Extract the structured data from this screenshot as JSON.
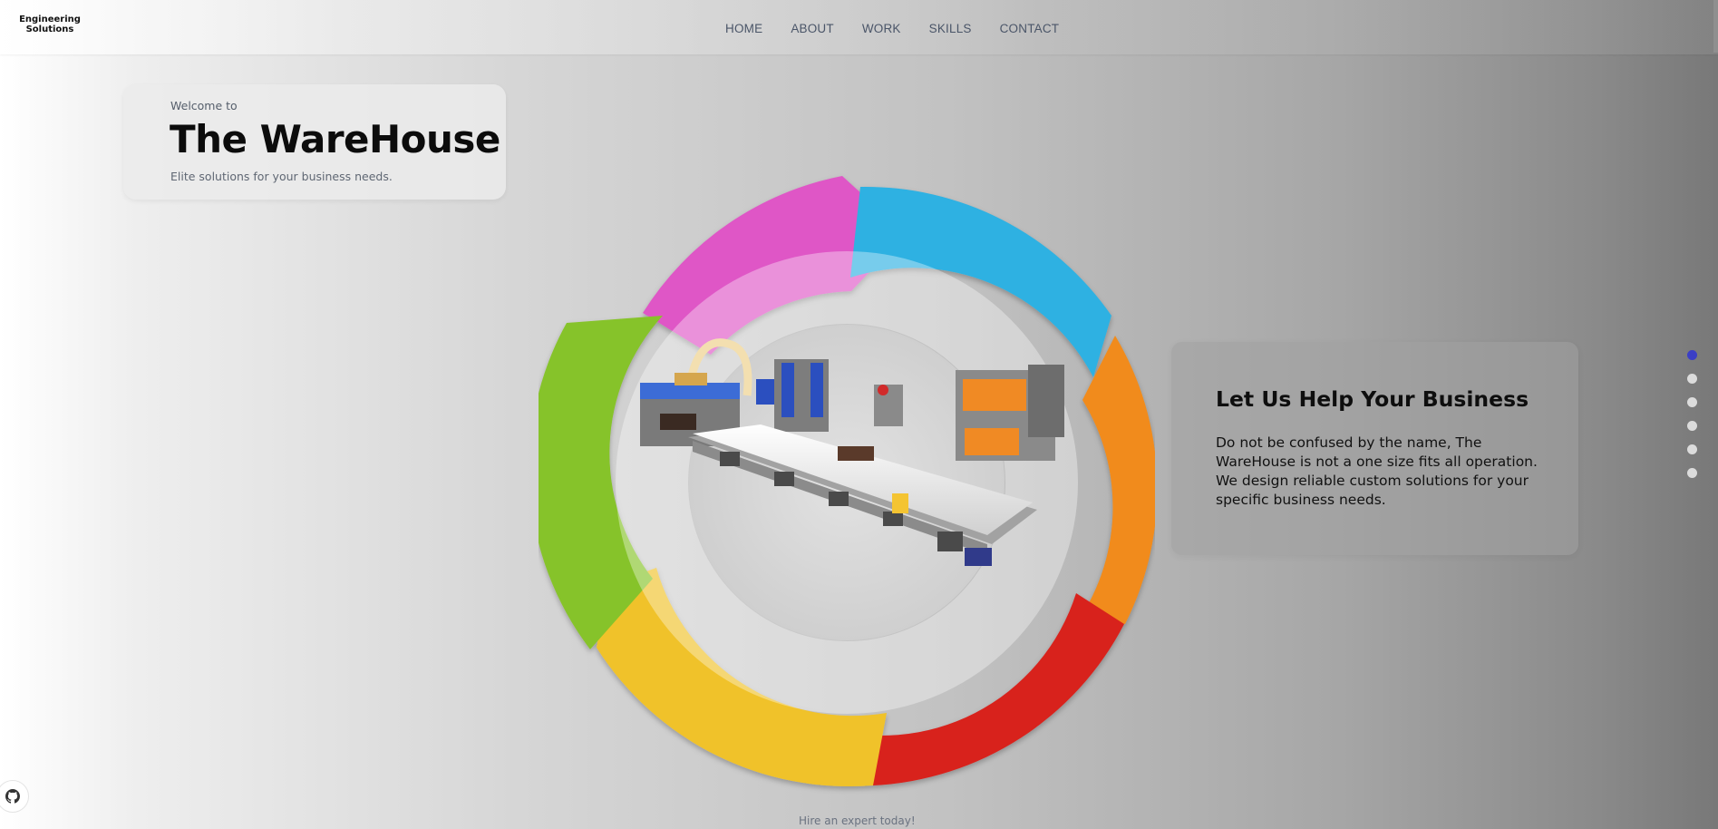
{
  "header": {
    "logo_line1": "Engineering",
    "logo_line2": "Solutions",
    "nav": [
      {
        "label": "HOME"
      },
      {
        "label": "ABOUT"
      },
      {
        "label": "WORK"
      },
      {
        "label": "SKILLS"
      },
      {
        "label": "CONTACT"
      }
    ]
  },
  "welcome": {
    "pre": "Welcome to",
    "title": "The WareHouse",
    "subtitle": "Elite solutions for your business needs."
  },
  "hero": {
    "image": "rainbow-cycle-wheel-with-conveyor-machine",
    "segment_colors": [
      "#e055c8",
      "#2fb0e0",
      "#f08c1c",
      "#d8221f",
      "#f1c52a",
      "#87c22a"
    ]
  },
  "help": {
    "title": "Let Us Help Your Business",
    "body": "Do not be confused by the name, The WareHouse is not a one size fits all operation. We design reliable custom solutions for your specific business needs."
  },
  "section_dots": {
    "count": 6,
    "active_index": 0,
    "active_color": "#3b3fc6"
  },
  "github": {
    "icon": "github-icon"
  },
  "footer": {
    "cta": "Hire an expert today!"
  }
}
